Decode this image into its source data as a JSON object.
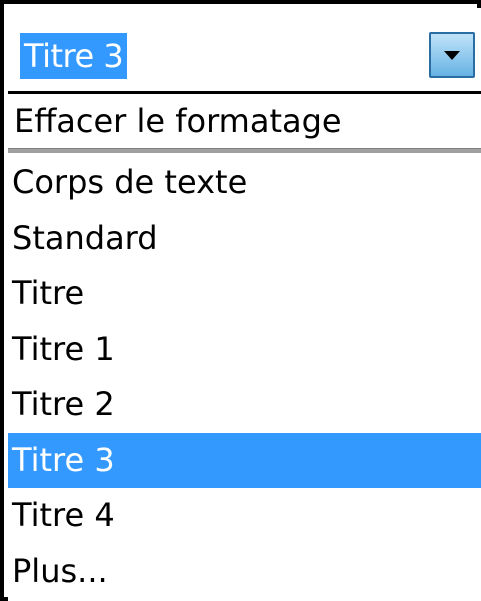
{
  "combo": {
    "value": "Titre 3",
    "button_icon": "chevron-down-icon"
  },
  "dropdown": {
    "clear_formatting_label": "Effacer le formatage",
    "items": [
      {
        "label": "Corps de texte",
        "selected": false
      },
      {
        "label": "Standard",
        "selected": false
      },
      {
        "label": "Titre",
        "selected": false
      },
      {
        "label": "Titre 1",
        "selected": false
      },
      {
        "label": "Titre 2",
        "selected": false
      },
      {
        "label": "Titre 3",
        "selected": true
      },
      {
        "label": "Titre 4",
        "selected": false
      },
      {
        "label": "Plus...",
        "selected": false
      }
    ]
  },
  "colors": {
    "selection": "#3399ff",
    "selection_text": "#ffffff",
    "border": "#000000",
    "separator": "#a0a0a0"
  }
}
